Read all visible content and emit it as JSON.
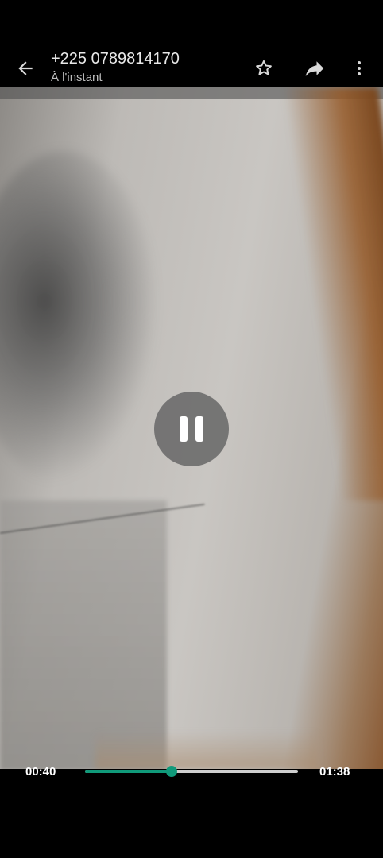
{
  "header": {
    "contact": "+225 0789814170",
    "timestamp": "À l'instant",
    "back_icon": "arrow-left-icon",
    "star_icon": "star-outline-icon",
    "forward_icon": "forward-icon",
    "menu_icon": "more-vertical-icon"
  },
  "player": {
    "state": "playing",
    "control_icon": "pause-icon",
    "current_time": "00:40",
    "total_time": "01:38",
    "progress": 0.408,
    "accent_color": "#109a7a"
  }
}
